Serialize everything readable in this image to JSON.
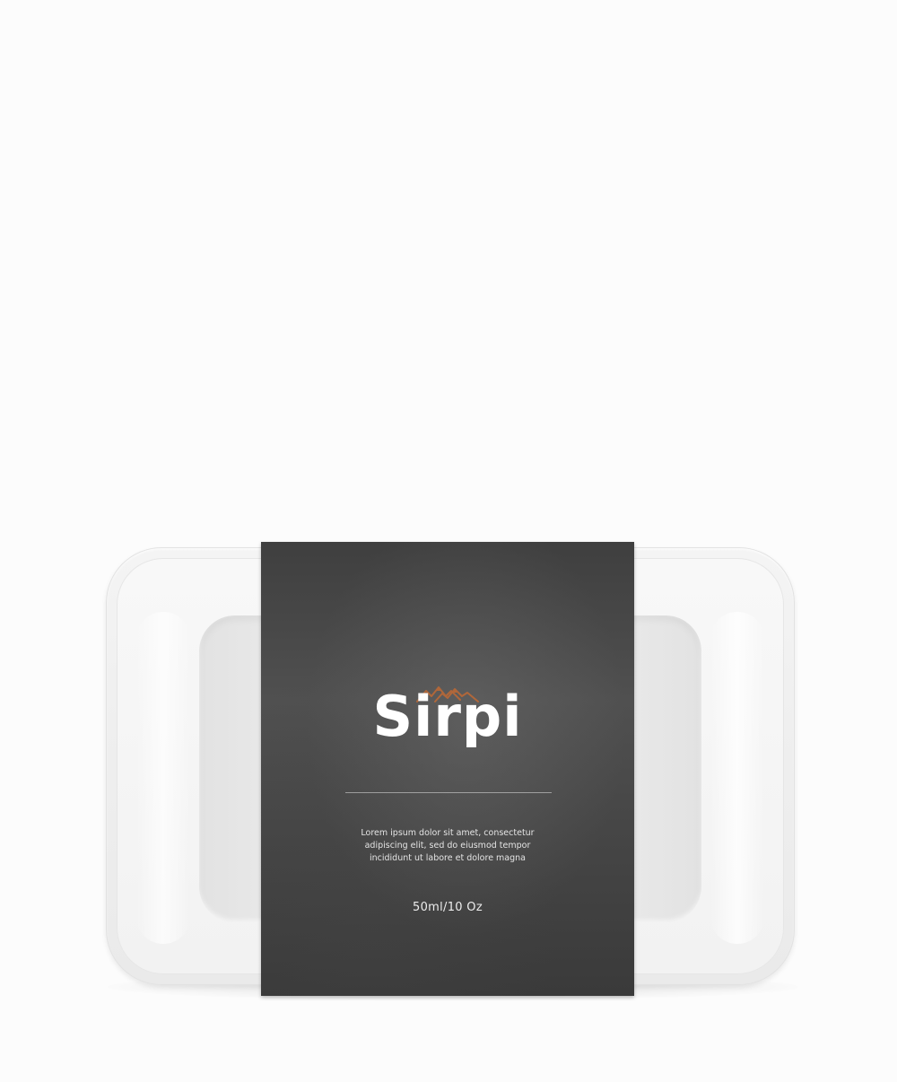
{
  "product": {
    "brand_name": "Sirpi",
    "description": "Lorem ipsum dolor sit amet, consectetur adipiscing elit, sed do eiusmod tempor incididunt ut labore et dolore magna",
    "volume": "50ml/10 Oz"
  },
  "colors": {
    "background": "#fcfcfc",
    "sleeve": "#474747",
    "logo_accent": "#b0673a",
    "brand_text": "#ffffff",
    "tray": "#f0f0f0"
  },
  "icons": {
    "logo": "mountain-logo-icon"
  }
}
